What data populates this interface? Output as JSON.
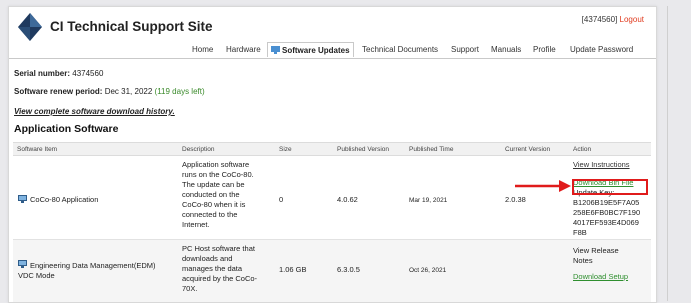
{
  "site": {
    "title": "CI Technical Support Site",
    "user_id": "[4374560]",
    "logout": "Logout"
  },
  "nav": {
    "items": [
      "Home",
      "Hardware",
      "Software Updates",
      "Technical Documents",
      "Support",
      "Manuals",
      "Profile",
      "Update Password"
    ],
    "active": "Software Updates"
  },
  "info": {
    "serial_label": "Serial number:",
    "serial_value": "4374560",
    "renew_label": "Software renew period:",
    "renew_value": "Dec 31, 2022",
    "renew_left": "(119 days left)",
    "history_link": "View complete software download history."
  },
  "section_title": "Application Software",
  "table": {
    "headers": [
      "Software Item",
      "Description",
      "Size",
      "Published Version",
      "Published Time",
      "Current Version",
      "Action"
    ],
    "rows": [
      {
        "item": "CoCo-80 Application",
        "description": [
          "Application software",
          "runs on the CoCo-80.",
          "The update can be",
          "conducted on the",
          "CoCo-80 when it is",
          "connected to the",
          "Internet."
        ],
        "size": "0",
        "published_version": "4.0.62",
        "published_time": "Mar 19, 2021",
        "current_version": "2.0.38",
        "action_view": "View Instructions",
        "action_download": "Download Bin File",
        "update_key_label": "Update Key:",
        "update_key": [
          "B1206B19E5F7A05",
          "258E6FB0BC7F190",
          "4017EF593E4D069",
          "F8B"
        ]
      },
      {
        "item_lines": [
          "Engineering Data Management(EDM)",
          "VDC Mode"
        ],
        "description": [
          "PC Host software that",
          "downloads and",
          "manages the data",
          "acquired by the CoCo-",
          "70X."
        ],
        "size": "1.06 GB",
        "published_version": "6.3.0.5",
        "published_time": "Oct 26, 2021",
        "action_view_lines": [
          "View Release",
          "Notes"
        ],
        "action_download": "Download Setup"
      }
    ]
  },
  "colors": {
    "logout": "#e03b1f",
    "renew_left": "#3a8a2a",
    "download_link": "#2f8f2f",
    "highlight": "#e01b1b",
    "logo": "#1f3a5f"
  }
}
